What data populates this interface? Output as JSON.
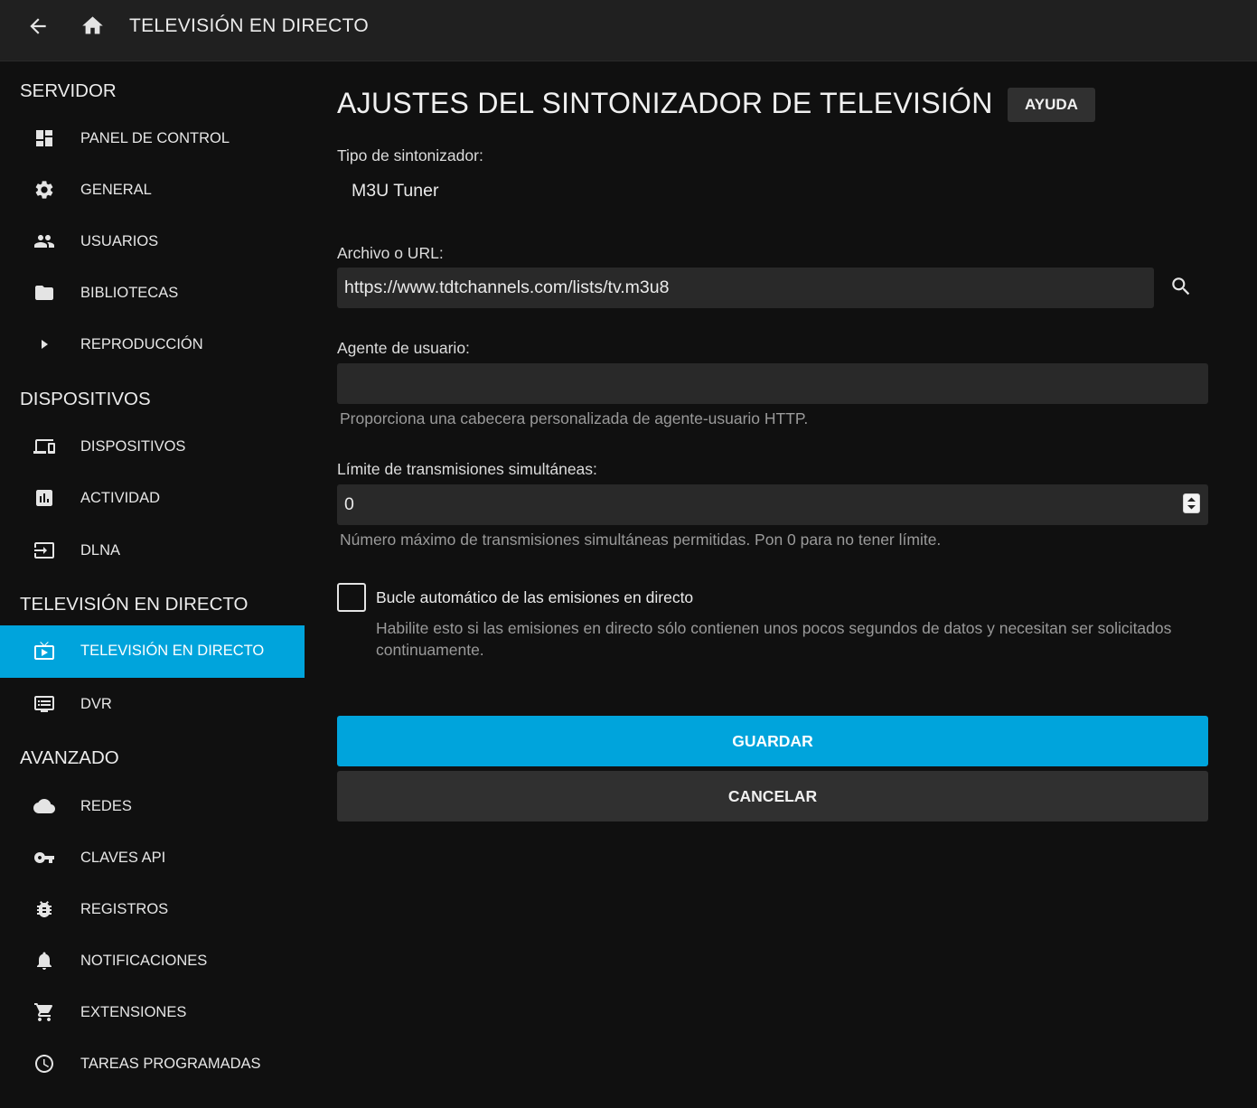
{
  "header": {
    "back_icon": "arrow-back-icon",
    "home_icon": "home-icon",
    "title": "TELEVISIÓN EN DIRECTO"
  },
  "sidebar": {
    "sections": [
      {
        "title": "SERVIDOR",
        "items": [
          {
            "label": "PANEL DE CONTROL",
            "icon": "dashboard-icon"
          },
          {
            "label": "GENERAL",
            "icon": "gear-icon"
          },
          {
            "label": "USUARIOS",
            "icon": "people-icon"
          },
          {
            "label": "BIBLIOTECAS",
            "icon": "folder-icon"
          },
          {
            "label": "REPRODUCCIÓN",
            "icon": "play-icon"
          }
        ]
      },
      {
        "title": "DISPOSITIVOS",
        "items": [
          {
            "label": "DISPOSITIVOS",
            "icon": "devices-icon"
          },
          {
            "label": "ACTIVIDAD",
            "icon": "chart-icon"
          },
          {
            "label": "DLNA",
            "icon": "input-icon"
          }
        ]
      },
      {
        "title": "TELEVISIÓN EN DIRECTO",
        "items": [
          {
            "label": "TELEVISIÓN EN DIRECTO",
            "icon": "live-tv-icon",
            "active": true
          },
          {
            "label": "DVR",
            "icon": "dvr-icon"
          }
        ]
      },
      {
        "title": "AVANZADO",
        "items": [
          {
            "label": "REDES",
            "icon": "cloud-icon"
          },
          {
            "label": "CLAVES API",
            "icon": "key-icon"
          },
          {
            "label": "REGISTROS",
            "icon": "bug-icon"
          },
          {
            "label": "NOTIFICACIONES",
            "icon": "bell-icon"
          },
          {
            "label": "EXTENSIONES",
            "icon": "cart-icon"
          },
          {
            "label": "TAREAS PROGRAMADAS",
            "icon": "clock-icon"
          }
        ]
      }
    ]
  },
  "main": {
    "title": "AJUSTES DEL SINTONIZADOR DE TELEVISIÓN",
    "help_label": "AYUDA",
    "tuner_type": {
      "label": "Tipo de sintonizador:",
      "value": "M3U Tuner"
    },
    "file_url": {
      "label": "Archivo o URL:",
      "value": "https://www.tdtchannels.com/lists/tv.m3u8",
      "icon": "search-icon"
    },
    "user_agent": {
      "label": "Agente de usuario:",
      "value": "",
      "hint": "Proporciona una cabecera personalizada de agente-usuario HTTP."
    },
    "stream_limit": {
      "label": "Límite de transmisiones simultáneas:",
      "value": "0",
      "hint": "Número máximo de transmisiones simultáneas permitidas. Pon 0 para no tener límite."
    },
    "auto_loop": {
      "label": "Bucle automático de las emisiones en directo",
      "checked": false,
      "hint": "Habilite esto si las emisiones en directo sólo contienen unos pocos segundos de datos y necesitan ser solicitados continuamente."
    },
    "save_label": "GUARDAR",
    "cancel_label": "CANCELAR"
  },
  "colors": {
    "accent": "#00a4dc",
    "background": "#101010",
    "header": "#202020",
    "input": "#292929"
  }
}
